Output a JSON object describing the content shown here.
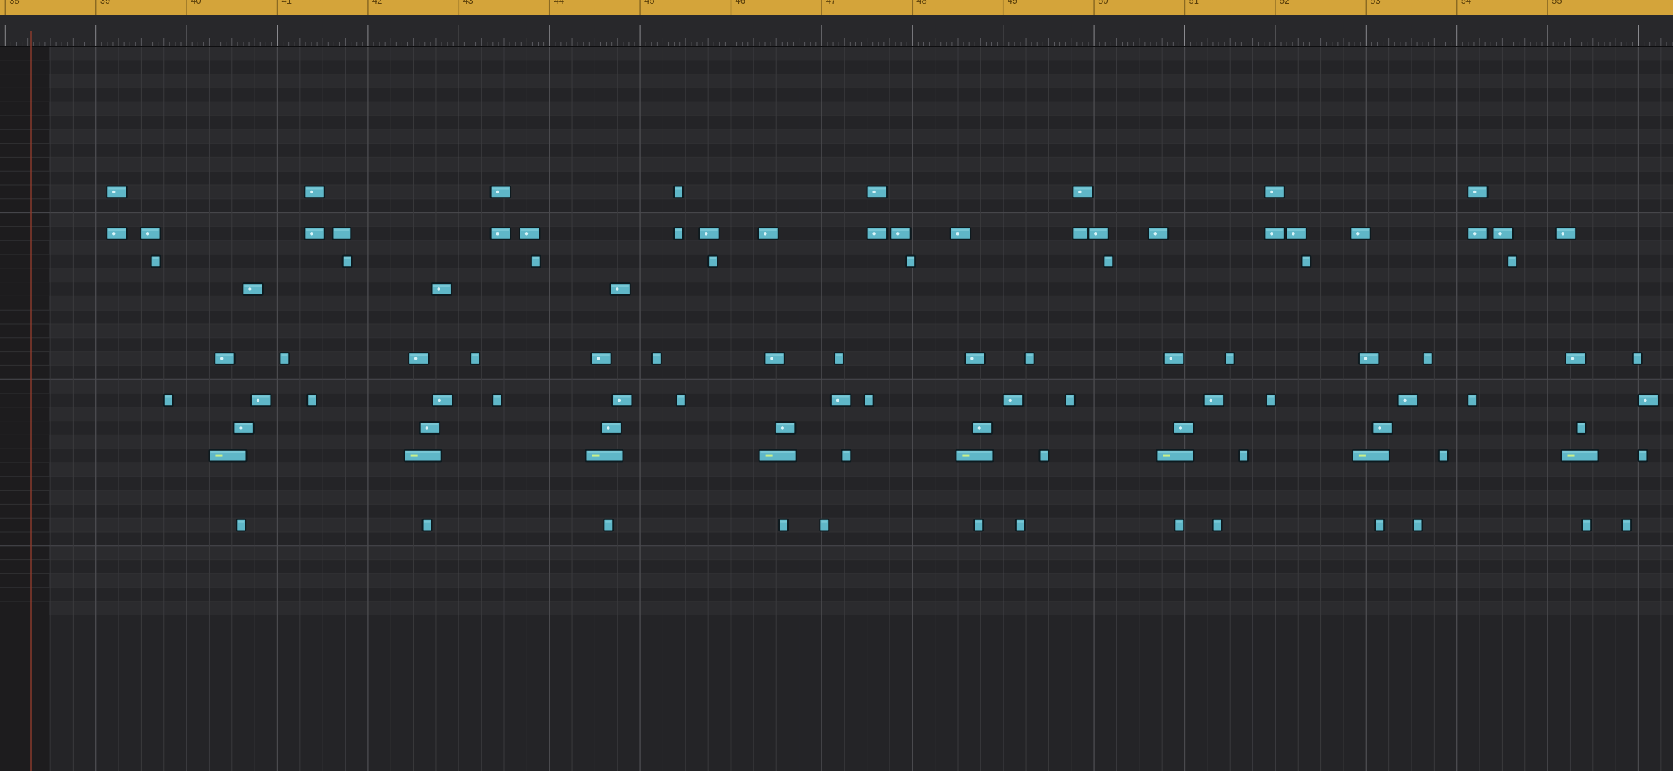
{
  "app": {
    "view": "piano-roll"
  },
  "ruler": {
    "color": "#d4a43a",
    "bar_labels": [
      "38",
      "39",
      "40",
      "41",
      "42",
      "43",
      "44",
      "45",
      "46",
      "47",
      "48",
      "49",
      "50",
      "51",
      "52",
      "53",
      "54",
      "55"
    ]
  },
  "grid": {
    "bars_visible": 18,
    "beats_per_bar": 4,
    "row_count": 41,
    "row_dark": "#242427",
    "row_light": "#2b2b2e",
    "line_color": "#3a3a3d",
    "bar_line_color": "#4a4a4e"
  },
  "note_style": {
    "fill": "#5fb7c8",
    "fill_highlight": "#a8e6ef",
    "outline": "#0d1a1f",
    "velocity_dot": "#d8f4f8",
    "long_note_marker": "#c9f08a"
  },
  "notes": [
    {
      "pitch": 10,
      "start": 0.62,
      "len": 0.22
    },
    {
      "pitch": 13,
      "start": 0.62,
      "len": 0.22
    },
    {
      "pitch": 13,
      "start": 0.99,
      "len": 0.22
    },
    {
      "pitch": 15,
      "start": 1.11,
      "len": 0.1
    },
    {
      "pitch": 17,
      "start": 2.12,
      "len": 0.22
    },
    {
      "pitch": 10,
      "start": 2.8,
      "len": 0.22
    },
    {
      "pitch": 13,
      "start": 2.8,
      "len": 0.22
    },
    {
      "pitch": 13,
      "start": 3.11,
      "len": 0.2
    },
    {
      "pitch": 15,
      "start": 3.22,
      "len": 0.1
    },
    {
      "pitch": 17,
      "start": 4.2,
      "len": 0.22
    },
    {
      "pitch": 10,
      "start": 4.85,
      "len": 0.22
    },
    {
      "pitch": 13,
      "start": 4.85,
      "len": 0.22
    },
    {
      "pitch": 13,
      "start": 5.17,
      "len": 0.22
    },
    {
      "pitch": 15,
      "start": 5.3,
      "len": 0.1
    },
    {
      "pitch": 17,
      "start": 6.17,
      "len": 0.22
    },
    {
      "pitch": 10,
      "start": 6.87,
      "len": 0.1
    },
    {
      "pitch": 13,
      "start": 6.87,
      "len": 0.1
    },
    {
      "pitch": 13,
      "start": 7.15,
      "len": 0.22
    },
    {
      "pitch": 15,
      "start": 7.25,
      "len": 0.1
    },
    {
      "pitch": 13,
      "start": 7.8,
      "len": 0.22
    },
    {
      "pitch": 10,
      "start": 9.0,
      "len": 0.22
    },
    {
      "pitch": 13,
      "start": 9.0,
      "len": 0.22
    },
    {
      "pitch": 13,
      "start": 9.26,
      "len": 0.22
    },
    {
      "pitch": 15,
      "start": 9.43,
      "len": 0.1
    },
    {
      "pitch": 13,
      "start": 9.92,
      "len": 0.22
    },
    {
      "pitch": 10,
      "start": 11.27,
      "len": 0.22
    },
    {
      "pitch": 13,
      "start": 11.27,
      "len": 0.16
    },
    {
      "pitch": 13,
      "start": 11.44,
      "len": 0.22
    },
    {
      "pitch": 15,
      "start": 11.61,
      "len": 0.1
    },
    {
      "pitch": 13,
      "start": 12.1,
      "len": 0.22
    },
    {
      "pitch": 10,
      "start": 13.38,
      "len": 0.22
    },
    {
      "pitch": 13,
      "start": 13.38,
      "len": 0.22
    },
    {
      "pitch": 13,
      "start": 13.62,
      "len": 0.22
    },
    {
      "pitch": 15,
      "start": 13.79,
      "len": 0.1
    },
    {
      "pitch": 13,
      "start": 14.33,
      "len": 0.22
    },
    {
      "pitch": 10,
      "start": 15.62,
      "len": 0.22
    },
    {
      "pitch": 13,
      "start": 15.62,
      "len": 0.22
    },
    {
      "pitch": 13,
      "start": 15.9,
      "len": 0.22
    },
    {
      "pitch": 15,
      "start": 16.06,
      "len": 0.1
    },
    {
      "pitch": 13,
      "start": 16.59,
      "len": 0.22
    },
    {
      "pitch": 22,
      "start": 1.81,
      "len": 0.22
    },
    {
      "pitch": 22,
      "start": 2.53,
      "len": 0.1
    },
    {
      "pitch": 25,
      "start": 1.25,
      "len": 0.1
    },
    {
      "pitch": 25,
      "start": 2.21,
      "len": 0.22
    },
    {
      "pitch": 25,
      "start": 2.83,
      "len": 0.1
    },
    {
      "pitch": 27,
      "start": 2.02,
      "len": 0.22
    },
    {
      "pitch": 29,
      "start": 1.75,
      "len": 0.41
    },
    {
      "pitch": 34,
      "start": 2.05,
      "len": 0.1
    },
    {
      "pitch": 22,
      "start": 3.95,
      "len": 0.22
    },
    {
      "pitch": 22,
      "start": 4.63,
      "len": 0.1
    },
    {
      "pitch": 25,
      "start": 4.21,
      "len": 0.22
    },
    {
      "pitch": 25,
      "start": 4.87,
      "len": 0.1
    },
    {
      "pitch": 27,
      "start": 4.07,
      "len": 0.22
    },
    {
      "pitch": 29,
      "start": 3.9,
      "len": 0.41
    },
    {
      "pitch": 34,
      "start": 4.1,
      "len": 0.1
    },
    {
      "pitch": 22,
      "start": 5.96,
      "len": 0.22
    },
    {
      "pitch": 22,
      "start": 6.63,
      "len": 0.1
    },
    {
      "pitch": 25,
      "start": 6.19,
      "len": 0.22
    },
    {
      "pitch": 25,
      "start": 6.9,
      "len": 0.1
    },
    {
      "pitch": 27,
      "start": 6.07,
      "len": 0.22
    },
    {
      "pitch": 29,
      "start": 5.9,
      "len": 0.41
    },
    {
      "pitch": 34,
      "start": 6.1,
      "len": 0.1
    },
    {
      "pitch": 22,
      "start": 7.87,
      "len": 0.22
    },
    {
      "pitch": 22,
      "start": 8.64,
      "len": 0.1
    },
    {
      "pitch": 25,
      "start": 8.6,
      "len": 0.22
    },
    {
      "pitch": 25,
      "start": 8.97,
      "len": 0.1
    },
    {
      "pitch": 27,
      "start": 7.99,
      "len": 0.22
    },
    {
      "pitch": 29,
      "start": 7.81,
      "len": 0.41
    },
    {
      "pitch": 29,
      "start": 8.72,
      "len": 0.1
    },
    {
      "pitch": 34,
      "start": 8.03,
      "len": 0.1
    },
    {
      "pitch": 34,
      "start": 8.48,
      "len": 0.1
    },
    {
      "pitch": 22,
      "start": 10.08,
      "len": 0.22
    },
    {
      "pitch": 22,
      "start": 10.74,
      "len": 0.1
    },
    {
      "pitch": 25,
      "start": 10.5,
      "len": 0.22
    },
    {
      "pitch": 25,
      "start": 11.19,
      "len": 0.1
    },
    {
      "pitch": 27,
      "start": 10.16,
      "len": 0.22
    },
    {
      "pitch": 29,
      "start": 9.98,
      "len": 0.41
    },
    {
      "pitch": 29,
      "start": 10.9,
      "len": 0.1
    },
    {
      "pitch": 34,
      "start": 10.18,
      "len": 0.1
    },
    {
      "pitch": 34,
      "start": 10.64,
      "len": 0.1
    },
    {
      "pitch": 22,
      "start": 12.27,
      "len": 0.22
    },
    {
      "pitch": 22,
      "start": 12.95,
      "len": 0.1
    },
    {
      "pitch": 25,
      "start": 12.71,
      "len": 0.22
    },
    {
      "pitch": 25,
      "start": 13.4,
      "len": 0.1
    },
    {
      "pitch": 27,
      "start": 12.38,
      "len": 0.22
    },
    {
      "pitch": 29,
      "start": 12.19,
      "len": 0.41
    },
    {
      "pitch": 29,
      "start": 13.1,
      "len": 0.1
    },
    {
      "pitch": 34,
      "start": 12.39,
      "len": 0.1
    },
    {
      "pitch": 34,
      "start": 12.81,
      "len": 0.1
    },
    {
      "pitch": 22,
      "start": 14.42,
      "len": 0.22
    },
    {
      "pitch": 22,
      "start": 15.13,
      "len": 0.1
    },
    {
      "pitch": 25,
      "start": 14.85,
      "len": 0.22
    },
    {
      "pitch": 25,
      "start": 15.62,
      "len": 0.1
    },
    {
      "pitch": 27,
      "start": 14.57,
      "len": 0.22
    },
    {
      "pitch": 29,
      "start": 14.35,
      "len": 0.41
    },
    {
      "pitch": 29,
      "start": 15.3,
      "len": 0.1
    },
    {
      "pitch": 34,
      "start": 14.6,
      "len": 0.1
    },
    {
      "pitch": 34,
      "start": 15.02,
      "len": 0.1
    },
    {
      "pitch": 22,
      "start": 16.7,
      "len": 0.22
    },
    {
      "pitch": 22,
      "start": 17.44,
      "len": 0.1
    },
    {
      "pitch": 25,
      "start": 17.5,
      "len": 0.22
    },
    {
      "pitch": 27,
      "start": 16.82,
      "len": 0.1
    },
    {
      "pitch": 29,
      "start": 16.65,
      "len": 0.41
    },
    {
      "pitch": 29,
      "start": 17.5,
      "len": 0.1
    },
    {
      "pitch": 34,
      "start": 16.88,
      "len": 0.1
    },
    {
      "pitch": 34,
      "start": 17.32,
      "len": 0.1
    }
  ]
}
